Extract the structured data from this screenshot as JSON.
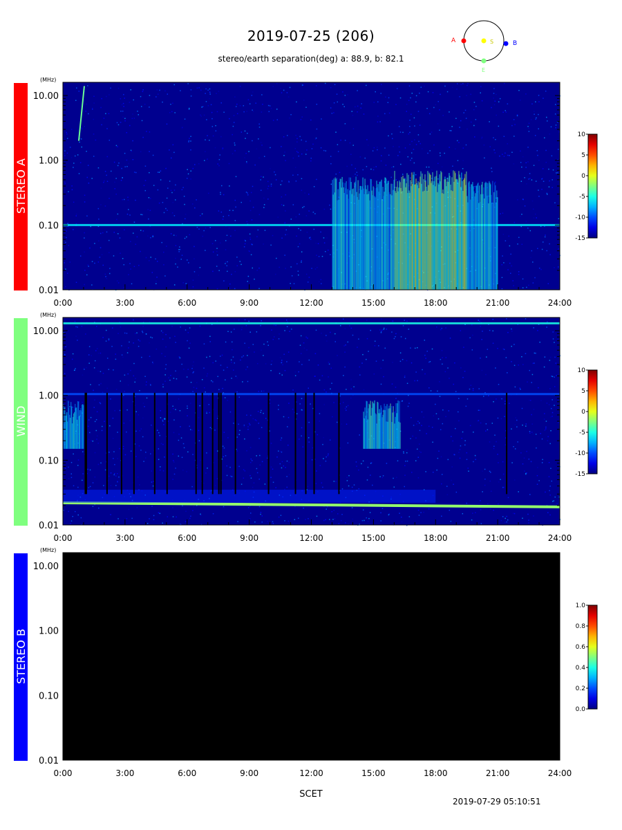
{
  "header": {
    "title": "2019-07-25 (206)",
    "subtitle": "stereo/earth separation(deg) a:  88.9, b:  82.1"
  },
  "orbit_diagram": {
    "labels": {
      "a": "A",
      "s": "S",
      "b": "B",
      "e": "E"
    },
    "colors": {
      "a": "#ff0000",
      "s": "#ffff00",
      "b": "#0000ff",
      "e": "#7fff7f"
    }
  },
  "footer": {
    "xlabel": "SCET",
    "timestamp": "2019-07-29 05:10:51"
  },
  "chart_data": [
    {
      "type": "heatmap",
      "panel_label": "STEREO A",
      "panel_color": "#ff0000",
      "unit_label": "(MHz)",
      "y_scale": "log",
      "y_range_mhz": [
        0.01,
        16.0
      ],
      "y_ticks": [
        "10.00",
        "1.00",
        "0.10",
        "0.01"
      ],
      "x_ticks": [
        "0:00",
        "3:00",
        "6:00",
        "9:00",
        "12:00",
        "15:00",
        "18:00",
        "21:00",
        "24:00"
      ],
      "x_range_hours": [
        0,
        24
      ],
      "colorbar": {
        "range": [
          -15,
          10
        ],
        "ticks": [
          "10",
          "5",
          "0",
          "-5",
          "-10",
          "-15"
        ]
      },
      "features": [
        {
          "kind": "band",
          "freq_mhz": 0.1,
          "intensity": -6
        },
        {
          "kind": "burst",
          "start_h": 13.0,
          "end_h": 16.0,
          "fmin": 0.01,
          "fmax": 0.4,
          "intensity": -4
        },
        {
          "kind": "burst",
          "start_h": 16.0,
          "end_h": 19.5,
          "fmin": 0.01,
          "fmax": 0.5,
          "intensity": 0
        },
        {
          "kind": "burst",
          "start_h": 19.5,
          "end_h": 21.0,
          "fmin": 0.01,
          "fmax": 0.35,
          "intensity": -4
        },
        {
          "kind": "type3",
          "time_h": 0.9,
          "fmin": 2.0,
          "fmax": 14.0,
          "intensity": -3
        }
      ]
    },
    {
      "type": "heatmap",
      "panel_label": "WIND",
      "panel_color": "#7fff7f",
      "unit_label": "(MHz)",
      "y_scale": "log",
      "y_range_mhz": [
        0.01,
        16.0
      ],
      "y_ticks": [
        "10.00",
        "1.00",
        "0.10",
        "0.01"
      ],
      "x_ticks": [
        "0:00",
        "3:00",
        "6:00",
        "9:00",
        "12:00",
        "15:00",
        "18:00",
        "21:00",
        "24:00"
      ],
      "x_range_hours": [
        0,
        24
      ],
      "colorbar": {
        "range": [
          -15,
          10
        ],
        "ticks": [
          "10",
          "5",
          "0",
          "-5",
          "-10",
          "-15"
        ]
      },
      "features": [
        {
          "kind": "plasma_line",
          "freq_mhz_start": 0.022,
          "freq_mhz_end": 0.019,
          "intensity": -2
        },
        {
          "kind": "band",
          "freq_mhz": 13.0,
          "intensity": -5
        },
        {
          "kind": "band",
          "freq_mhz": 1.05,
          "intensity": -10
        },
        {
          "kind": "burst",
          "start_h": 14.5,
          "end_h": 16.3,
          "fmin": 0.15,
          "fmax": 0.6,
          "intensity": -3
        },
        {
          "kind": "burst",
          "start_h": 0.0,
          "end_h": 1.0,
          "fmin": 0.15,
          "fmax": 0.6,
          "intensity": -4
        }
      ],
      "data_gaps_h": [
        1.05,
        1.1,
        2.1,
        2.8,
        3.4,
        4.4,
        5.0,
        6.4,
        6.7,
        7.2,
        7.5,
        7.6,
        8.3,
        9.9,
        11.2,
        11.7,
        12.1,
        13.3,
        21.4
      ]
    },
    {
      "type": "heatmap",
      "panel_label": "STEREO B",
      "panel_color": "#0000ff",
      "unit_label": "(MHz)",
      "y_scale": "log",
      "y_range_mhz": [
        0.01,
        16.0
      ],
      "y_ticks": [
        "10.00",
        "1.00",
        "0.10",
        "0.01"
      ],
      "x_ticks": [
        "0:00",
        "3:00",
        "6:00",
        "9:00",
        "12:00",
        "15:00",
        "18:00",
        "21:00",
        "24:00"
      ],
      "x_range_hours": [
        0,
        24
      ],
      "colorbar": {
        "range": [
          0.0,
          1.0
        ],
        "ticks": [
          "1.0",
          "0.8",
          "0.6",
          "0.4",
          "0.2",
          "0.0"
        ]
      },
      "no_data": true
    }
  ]
}
